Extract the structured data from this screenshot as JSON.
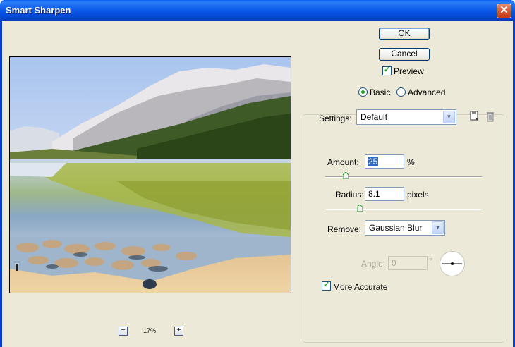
{
  "window": {
    "title": "Smart Sharpen"
  },
  "buttons": {
    "ok": "OK",
    "cancel": "Cancel"
  },
  "preview": {
    "label": "Preview",
    "checked": true
  },
  "mode": {
    "basic": "Basic",
    "advanced": "Advanced",
    "selected": "Basic"
  },
  "settings": {
    "label": "Settings:",
    "value": "Default"
  },
  "amount": {
    "label": "Amount:",
    "value": "25",
    "unit": "%",
    "slider_fraction": 0.13
  },
  "radius": {
    "label": "Radius:",
    "value": "8.1",
    "unit": "pixels",
    "slider_fraction": 0.22
  },
  "remove": {
    "label": "Remove:",
    "value": "Gaussian Blur"
  },
  "angle": {
    "label": "Angle:",
    "value": "0",
    "unit": "°"
  },
  "more_accurate": {
    "label": "More Accurate",
    "checked": true
  },
  "zoom": {
    "level": "17%",
    "minus": "−",
    "plus": "+"
  },
  "icons": {
    "close": "close-icon",
    "save": "save-settings-icon",
    "delete": "trash-icon"
  }
}
